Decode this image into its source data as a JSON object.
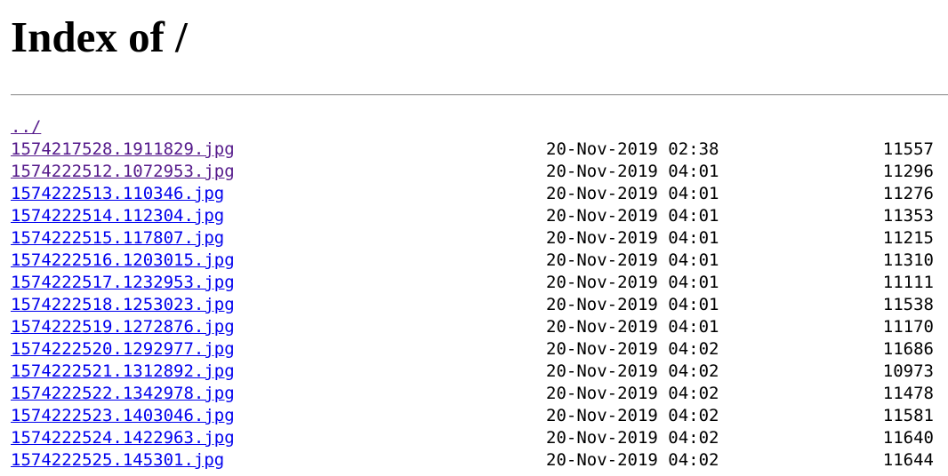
{
  "page": {
    "title": "Index of /"
  },
  "parent": {
    "label": "../"
  },
  "files": [
    {
      "name": "1574217528.1911829.jpg",
      "date": "20-Nov-2019 02:38",
      "size": "11557",
      "visited": true
    },
    {
      "name": "1574222512.1072953.jpg",
      "date": "20-Nov-2019 04:01",
      "size": "11296",
      "visited": true
    },
    {
      "name": "1574222513.110346.jpg",
      "date": "20-Nov-2019 04:01",
      "size": "11276",
      "visited": false
    },
    {
      "name": "1574222514.112304.jpg",
      "date": "20-Nov-2019 04:01",
      "size": "11353",
      "visited": false
    },
    {
      "name": "1574222515.117807.jpg",
      "date": "20-Nov-2019 04:01",
      "size": "11215",
      "visited": false
    },
    {
      "name": "1574222516.1203015.jpg",
      "date": "20-Nov-2019 04:01",
      "size": "11310",
      "visited": false
    },
    {
      "name": "1574222517.1232953.jpg",
      "date": "20-Nov-2019 04:01",
      "size": "11111",
      "visited": false
    },
    {
      "name": "1574222518.1253023.jpg",
      "date": "20-Nov-2019 04:01",
      "size": "11538",
      "visited": false
    },
    {
      "name": "1574222519.1272876.jpg",
      "date": "20-Nov-2019 04:01",
      "size": "11170",
      "visited": false
    },
    {
      "name": "1574222520.1292977.jpg",
      "date": "20-Nov-2019 04:02",
      "size": "11686",
      "visited": false
    },
    {
      "name": "1574222521.1312892.jpg",
      "date": "20-Nov-2019 04:02",
      "size": "10973",
      "visited": false
    },
    {
      "name": "1574222522.1342978.jpg",
      "date": "20-Nov-2019 04:02",
      "size": "11478",
      "visited": false
    },
    {
      "name": "1574222523.1403046.jpg",
      "date": "20-Nov-2019 04:02",
      "size": "11581",
      "visited": false
    },
    {
      "name": "1574222524.1422963.jpg",
      "date": "20-Nov-2019 04:02",
      "size": "11640",
      "visited": false
    },
    {
      "name": "1574222525.145301.jpg",
      "date": "20-Nov-2019 04:02",
      "size": "11644",
      "visited": false
    }
  ],
  "colors": {
    "link": "#0000ee",
    "visited_link": "#551a8b",
    "text": "#000000",
    "background": "#ffffff"
  }
}
